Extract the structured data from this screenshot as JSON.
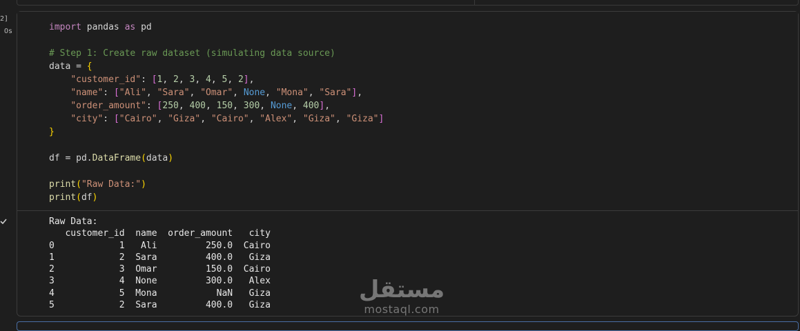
{
  "gutter": {
    "exec_count": "2]",
    "exec_time": "Os"
  },
  "code_lines": [
    "import pandas as pd",
    "",
    "# Step 1: Create raw dataset (simulating data source)",
    "data = {",
    "    \"customer_id\": [1, 2, 3, 4, 5, 2],",
    "    \"name\": [\"Ali\", \"Sara\", \"Omar\", None, \"Mona\", \"Sara\"],",
    "    \"order_amount\": [250, 400, 150, 300, None, 400],",
    "    \"city\": [\"Cairo\", \"Giza\", \"Cairo\", \"Alex\", \"Giza\", \"Giza\"]",
    "}",
    "",
    "df = pd.DataFrame(data)",
    "",
    "print(\"Raw Data:\")",
    "print(df)"
  ],
  "output_lines": [
    "Raw Data:",
    "   customer_id  name  order_amount   city",
    "0            1   Ali         250.0  Cairo",
    "1            2  Sara         400.0   Giza",
    "2            3  Omar         150.0  Cairo",
    "3            4  None         300.0   Alex",
    "4            5  Mona           NaN   Giza",
    "5            2  Sara         400.0   Giza"
  ],
  "watermark": {
    "arabic": "مستقل",
    "latin": "mostaql.com"
  },
  "icons": {
    "status": "check-icon"
  },
  "colors": {
    "background": "#1e1e1e",
    "keyword": "#c586c0",
    "constant": "#569cd6",
    "function": "#dcdcaa",
    "string": "#ce9178",
    "number": "#b5cea8",
    "comment": "#6a9955"
  }
}
